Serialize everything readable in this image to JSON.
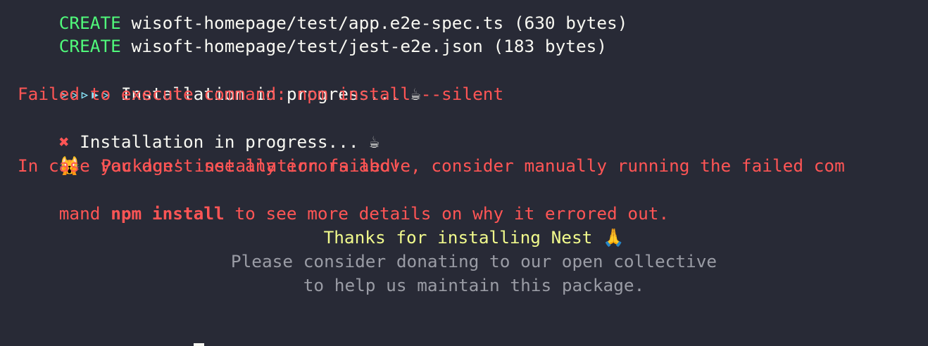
{
  "terminal": {
    "lines": {
      "create_1_keyword": "CREATE",
      "create_1_text": " wisoft-homepage/test/app.e2e-spec.ts (630 bytes)",
      "create_2_keyword": "CREATE",
      "create_2_text": " wisoft-homepage/test/jest-e2e.json (183 bytes)",
      "progress_spinner": "▹▹▹▸▹",
      "progress_text": " Installation in progress... ☕",
      "failed_command": "Failed to execute command: npm install --silent",
      "fail_mark": "✖",
      "fail_progress_text": " Installation in progress... ☕",
      "packages_emoji": "🙀",
      "packages_failed": "  Packages installation failed!",
      "help_line_1": "In case you don't see any errors above, consider manually running the failed com",
      "help_line_2_start": "mand ",
      "help_line_2_bold": "npm install",
      "help_line_2_end": " to see more details on why it errored out.",
      "thanks": "Thanks for installing Nest 🙏",
      "donate_1": "Please consider donating to our open collective",
      "donate_2": "to help us maintain this package."
    },
    "colors": {
      "background": "#282a36",
      "success": "#50fa7b",
      "error": "#ff5555",
      "highlight": "#f1fa8c",
      "muted": "#9a9ca5"
    }
  }
}
